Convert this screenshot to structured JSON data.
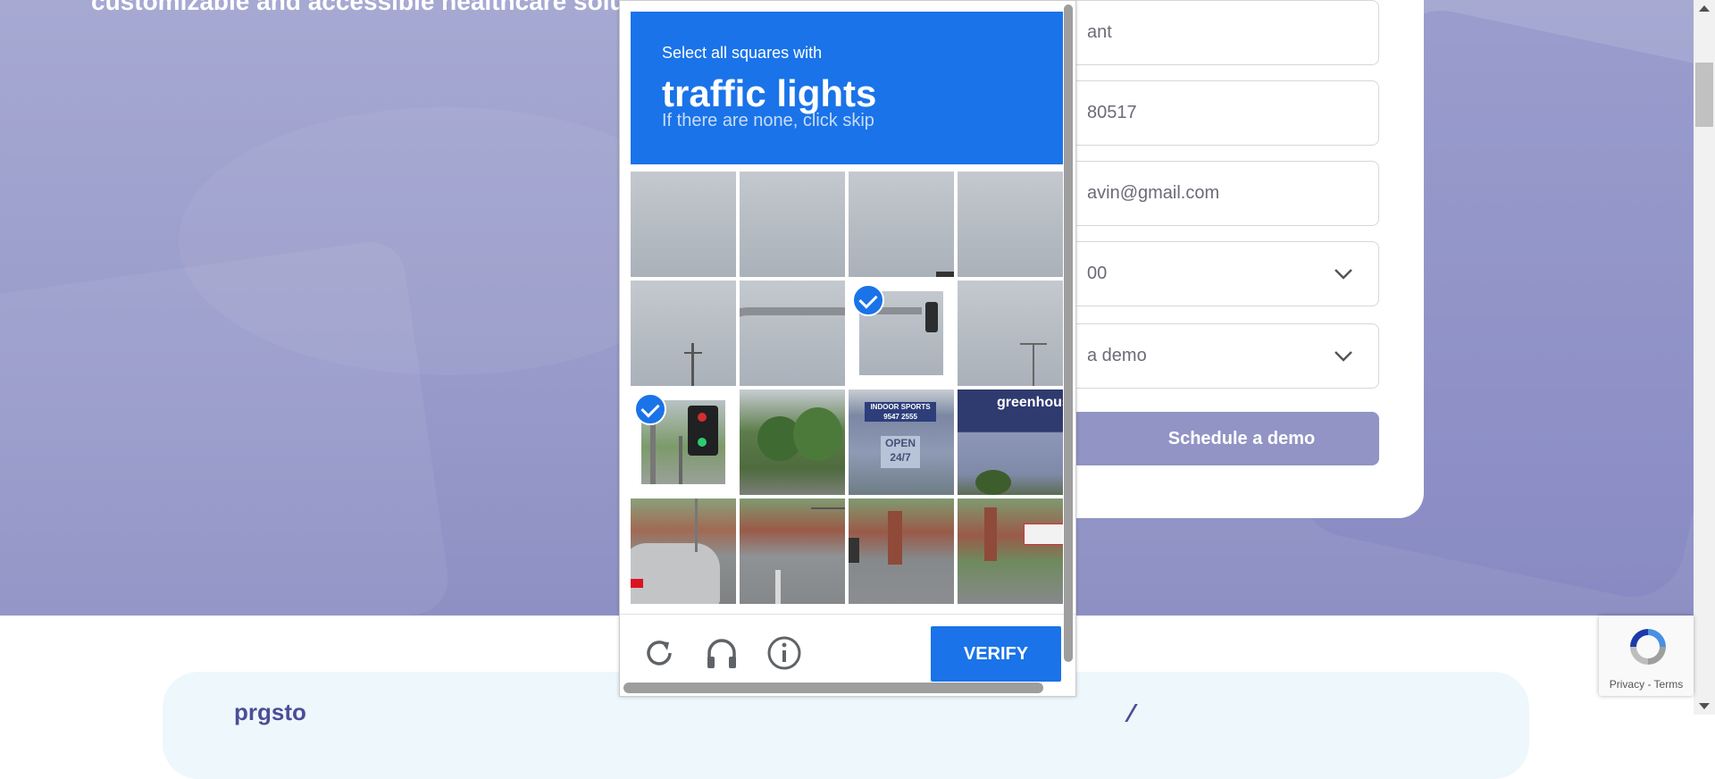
{
  "hero": {
    "heading": "customizable and accessible healthcare solutions"
  },
  "form": {
    "fields": [
      {
        "value": "ant"
      },
      {
        "value": "80517"
      },
      {
        "value": "avin@gmail.com"
      },
      {
        "value": "00",
        "dropdown": true
      },
      {
        "value": "a demo",
        "dropdown": true
      }
    ],
    "submit_label": "Schedule a demo"
  },
  "lower": {
    "text": "prgsto"
  },
  "captcha": {
    "instruction": "Select all squares with",
    "target": "traffic lights",
    "hint": "If there are none, click skip",
    "tiles": [
      {
        "row": 0,
        "col": 0,
        "selected": false
      },
      {
        "row": 0,
        "col": 1,
        "selected": false
      },
      {
        "row": 0,
        "col": 2,
        "selected": false
      },
      {
        "row": 0,
        "col": 3,
        "selected": false
      },
      {
        "row": 1,
        "col": 0,
        "selected": false
      },
      {
        "row": 1,
        "col": 1,
        "selected": false
      },
      {
        "row": 1,
        "col": 2,
        "selected": true
      },
      {
        "row": 1,
        "col": 3,
        "selected": false
      },
      {
        "row": 2,
        "col": 0,
        "selected": true
      },
      {
        "row": 2,
        "col": 1,
        "selected": false
      },
      {
        "row": 2,
        "col": 2,
        "selected": false
      },
      {
        "row": 2,
        "col": 3,
        "selected": false
      },
      {
        "row": 3,
        "col": 0,
        "selected": false
      },
      {
        "row": 3,
        "col": 1,
        "selected": false
      },
      {
        "row": 3,
        "col": 2,
        "selected": false
      },
      {
        "row": 3,
        "col": 3,
        "selected": false
      }
    ],
    "tile_signs": {
      "indoor_sports": "INDOOR SPORTS",
      "phone": "9547 2555",
      "open": "OPEN",
      "hours": "24/7",
      "greenhouse": "greenhouse"
    },
    "buttons": {
      "reload_icon": "reload-icon",
      "audio_icon": "headphones-icon",
      "info_icon": "info-icon",
      "verify_label": "VERIFY"
    },
    "accent_color": "#1a73e8"
  },
  "badge": {
    "terms": "Privacy - Terms"
  }
}
